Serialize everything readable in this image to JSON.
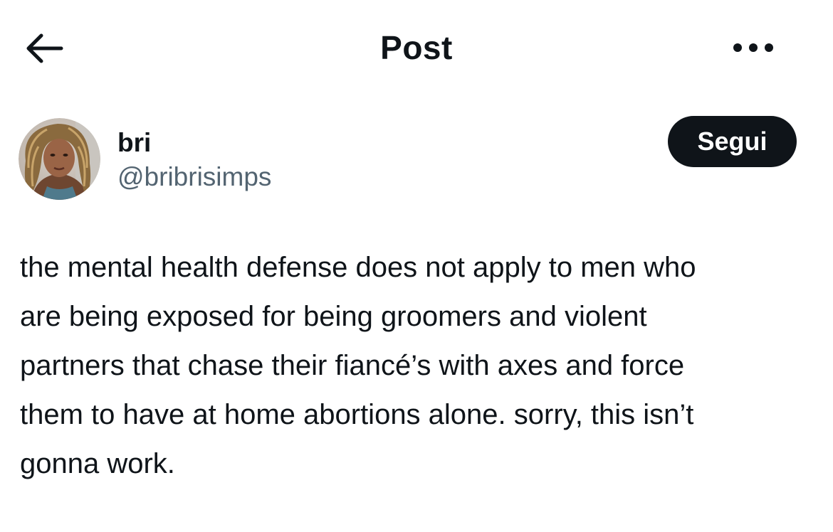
{
  "header": {
    "title": "Post",
    "back_icon": "arrow-left-icon",
    "more_icon": "more-horizontal-icon"
  },
  "author": {
    "name": "bri",
    "handle": "@bribrisimps",
    "follow_label": "Segui"
  },
  "post": {
    "text": "the mental health defense does not apply to men who\nare being exposed for being groomers and violent\npartners that chase their fiancé’s with axes and force\nthem to have at home abortions alone. sorry, this isn’t\ngonna work."
  },
  "colors": {
    "text_primary": "#0f1419",
    "text_secondary": "#536471",
    "button_bg": "#0f1419",
    "button_text": "#ffffff",
    "background": "#ffffff"
  }
}
